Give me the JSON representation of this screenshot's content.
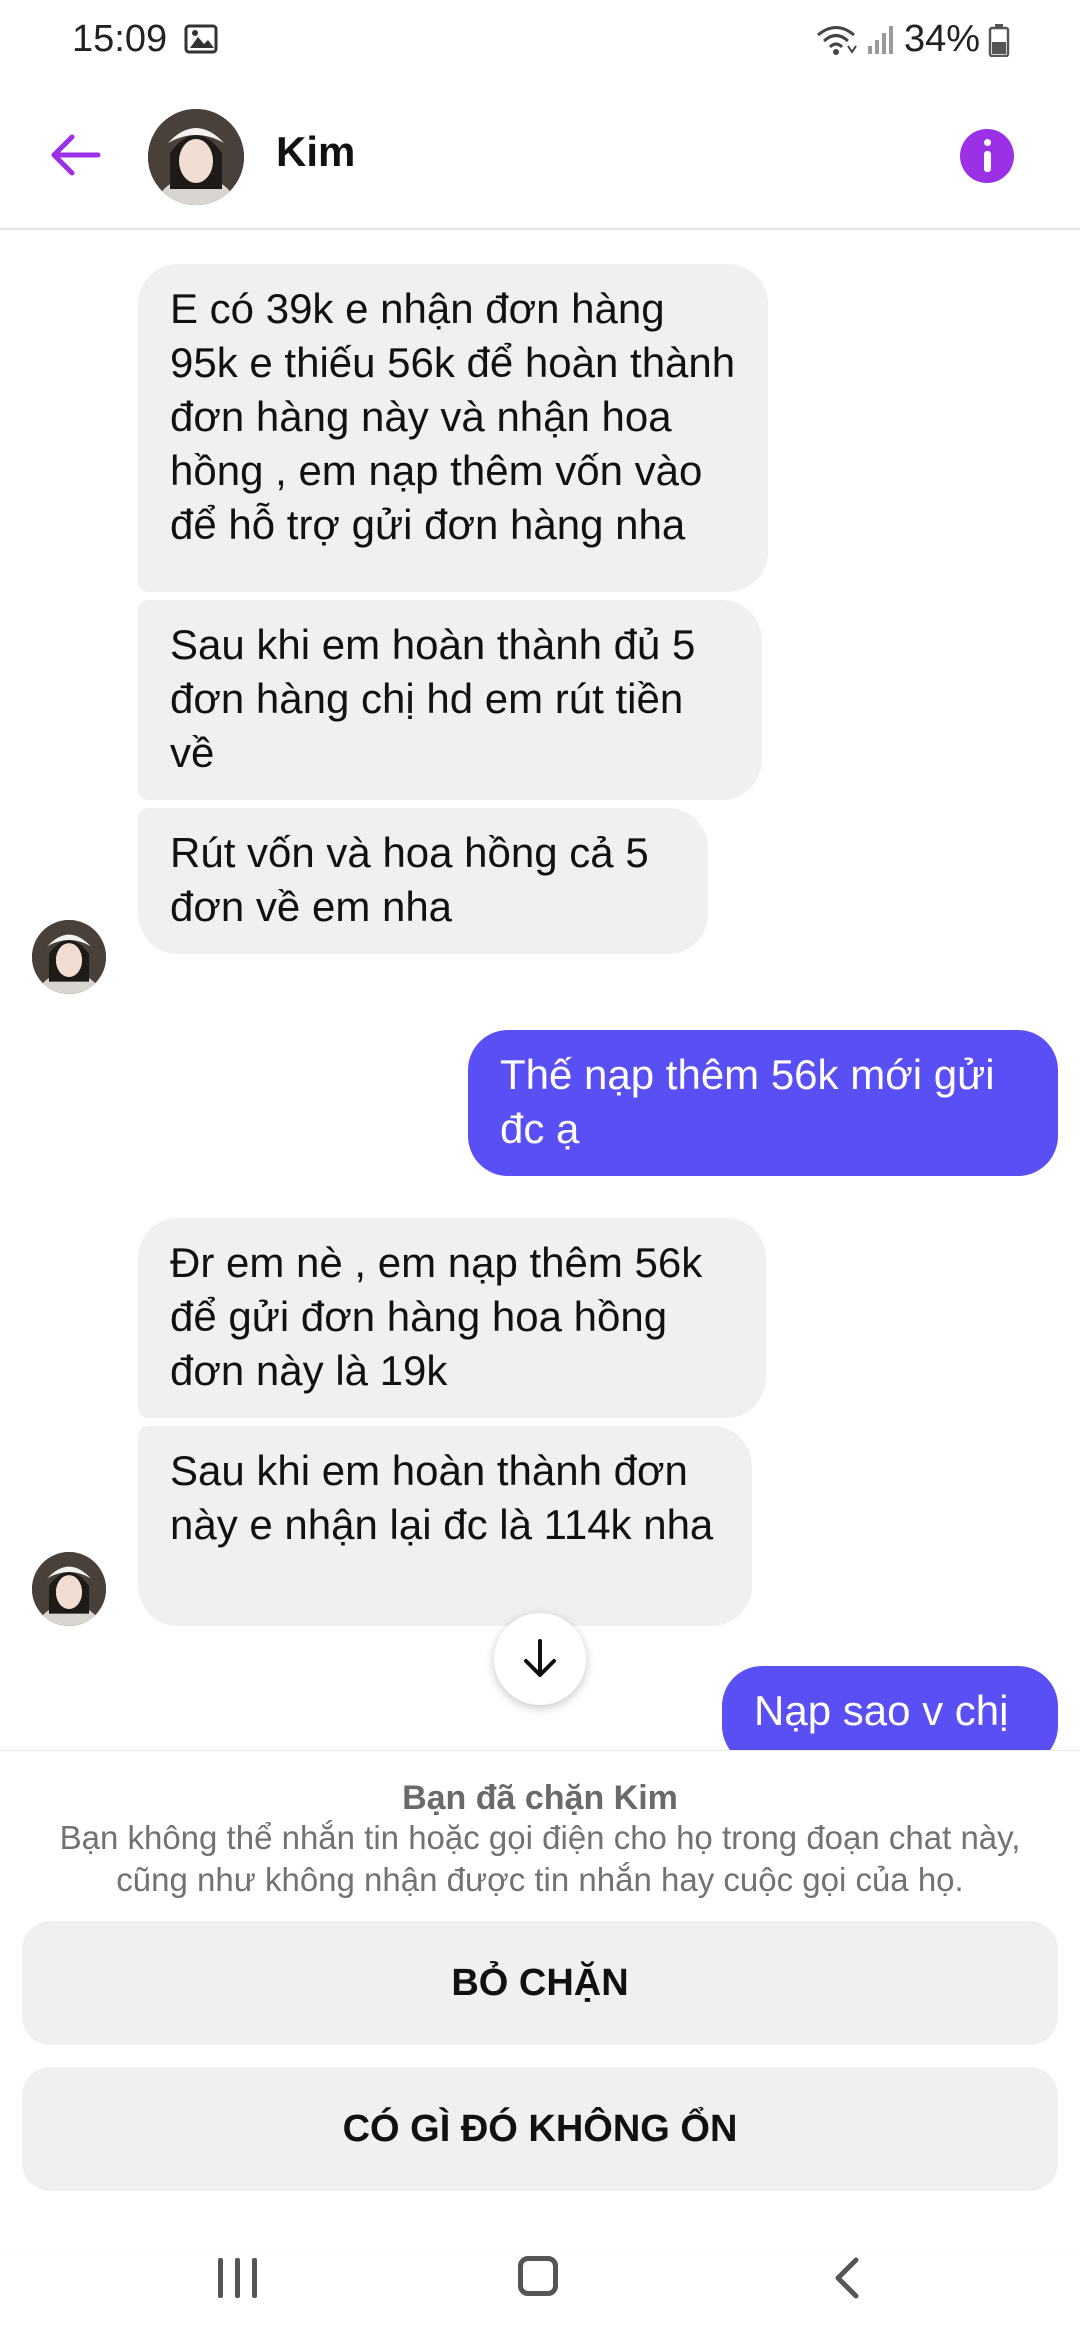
{
  "status_bar": {
    "time": "15:09",
    "battery": "34%",
    "icons": [
      "gallery-icon",
      "wifi-icon",
      "signal-icon",
      "battery-icon"
    ]
  },
  "header": {
    "contact_name": "Kim",
    "icons": {
      "back": "arrow-left-icon",
      "info": "info-icon"
    },
    "accent_color": "#9b30e6"
  },
  "messages": [
    {
      "direction": "in",
      "text": "E có 39k e nhận đơn hàng 95k e thiếu 56k để hoàn thành đơn hàng này và nhận hoa hồng , em nạp thêm vốn vào để hỗ trợ gửi đơn hàng nha"
    },
    {
      "direction": "in",
      "text": "Sau khi em hoàn thành đủ 5 đơn hàng chị hd em rút tiền về"
    },
    {
      "direction": "in",
      "text": "Rút vốn và hoa hồng cả 5 đơn về em nha"
    },
    {
      "direction": "out",
      "text": "Thế nạp thêm 56k mới gửi đc ạ"
    },
    {
      "direction": "in",
      "text": "Đr em nè , em nạp thêm 56k để gửi đơn hàng hoa hồng đơn này là 19k"
    },
    {
      "direction": "in",
      "text": "Sau khi em hoàn thành đơn này e nhận lại đc là 114k nha"
    },
    {
      "direction": "out",
      "text": "Nạp sao v chị"
    }
  ],
  "bubble_colors": {
    "incoming": "#f0f0f0",
    "outgoing": "#5a4ff5"
  },
  "scroll_button_icon": "arrow-down-icon",
  "blocked": {
    "title": "Bạn đã chặn Kim",
    "description": "Bạn không thể nhắn tin hoặc gọi điện cho họ trong đoạn chat này, cũng như không nhận được tin nhắn hay cuộc gọi của họ.",
    "unblock_label": "BỎ CHẶN",
    "report_label": "CÓ GÌ ĐÓ KHÔNG ỔN"
  },
  "nav_bar": {
    "icons": [
      "recents-icon",
      "home-icon",
      "back-icon"
    ]
  }
}
